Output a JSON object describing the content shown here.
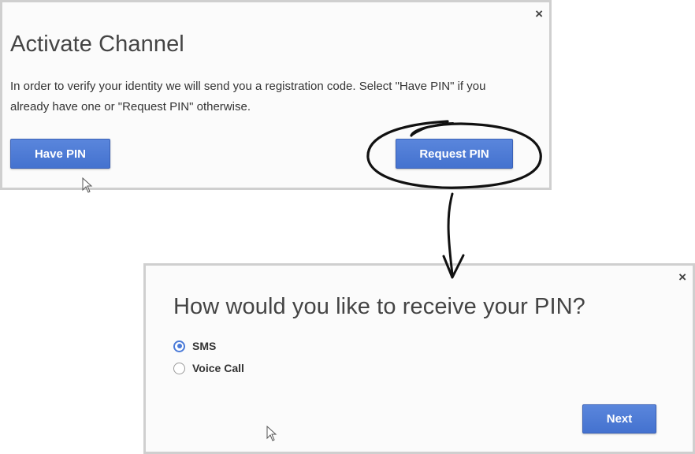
{
  "activate_dialog": {
    "title": "Activate Channel",
    "message": "In order to verify your identity we will send you a registration code. Select \"Have PIN\" if you already have one or \"Request PIN\" otherwise.",
    "have_pin_label": "Have PIN",
    "request_pin_label": "Request PIN",
    "close_glyph": "×"
  },
  "pin_dialog": {
    "title": "How would you like to receive your PIN?",
    "options": [
      {
        "label": "SMS",
        "selected": true
      },
      {
        "label": "Voice Call",
        "selected": false
      }
    ],
    "next_label": "Next",
    "close_glyph": "×"
  },
  "colors": {
    "button_blue": "#4a78d6",
    "annotation": "#111111",
    "dialog_border": "#cfcfcf"
  }
}
